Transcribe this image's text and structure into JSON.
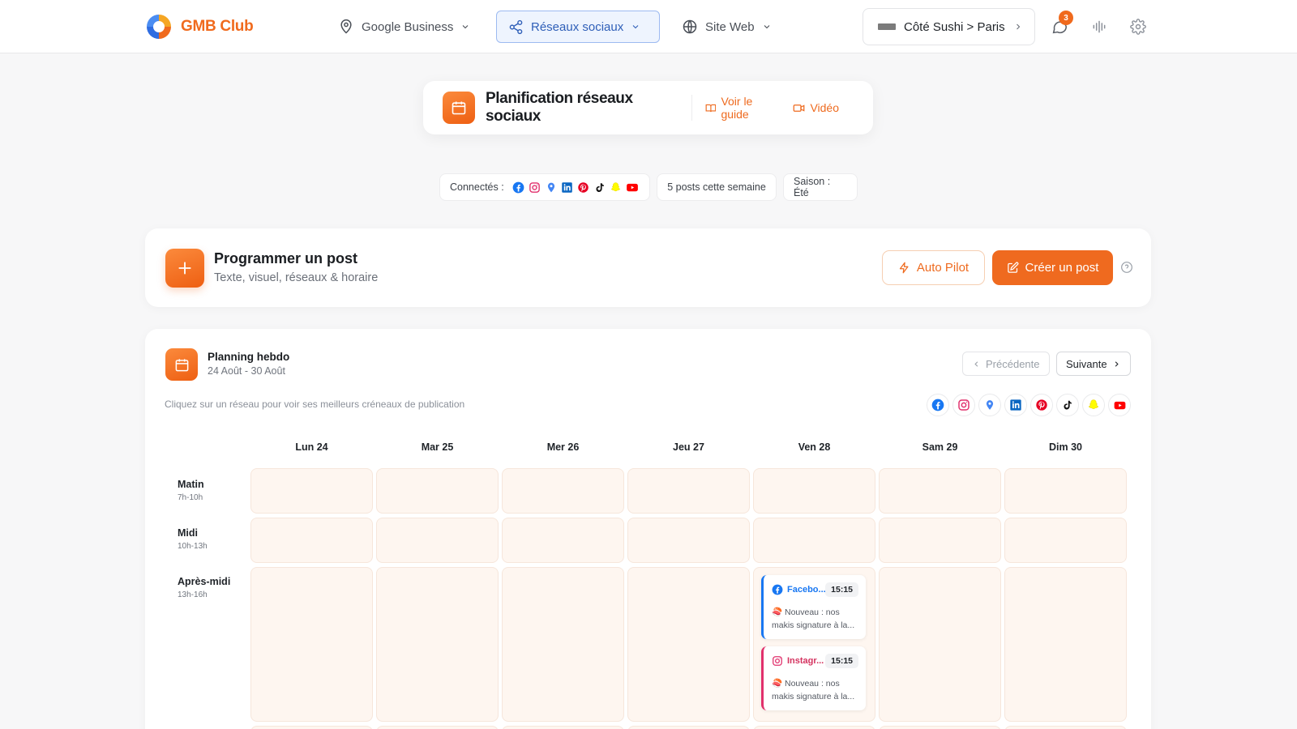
{
  "app": {
    "brand": "GMB Club",
    "accent": "#f06a1d"
  },
  "nav": {
    "google": "Google Business",
    "social": "Réseaux sociaux",
    "site": "Site Web"
  },
  "business": {
    "label": "Côté Sushi > Paris"
  },
  "notifications": {
    "count": "3"
  },
  "header": {
    "title": "Planification réseaux sociaux",
    "guide": "Voir le guide",
    "video": "Vidéo"
  },
  "status": {
    "connected_label": "Connectés :",
    "networks": [
      "facebook-icon",
      "instagram-icon",
      "google-maps-icon",
      "linkedin-icon",
      "pinterest-icon",
      "tiktok-icon",
      "snapchat-icon",
      "youtube-icon"
    ],
    "posts_week": "5 posts cette semaine",
    "season": "Saison : Été"
  },
  "program": {
    "title": "Programmer un post",
    "subtitle": "Texte, visuel, réseaux & horaire",
    "autopilot": "Auto Pilot",
    "create": "Créer un post"
  },
  "planning": {
    "title": "Planning hebdo",
    "range": "24 Août - 30 Août",
    "prev": "Précédente",
    "next": "Suivante",
    "hint": "Cliquez sur un réseau pour voir ses meilleurs créneaux de publication",
    "days": [
      "Lun 24",
      "Mar 25",
      "Mer 26",
      "Jeu 27",
      "Ven 28",
      "Sam 29",
      "Dim 30"
    ],
    "slots": [
      {
        "label": "Matin",
        "range": "7h-10h"
      },
      {
        "label": "Midi",
        "range": "10h-13h"
      },
      {
        "label": "Après-midi",
        "range": "13h-16h"
      }
    ],
    "posts": [
      {
        "network": "Facebo...",
        "time": "15:15",
        "text": "🍣 Nouveau : nos makis signature à la..."
      },
      {
        "network": "Instagr...",
        "time": "15:15",
        "text": "🍣 Nouveau : nos makis signature à la..."
      }
    ]
  }
}
